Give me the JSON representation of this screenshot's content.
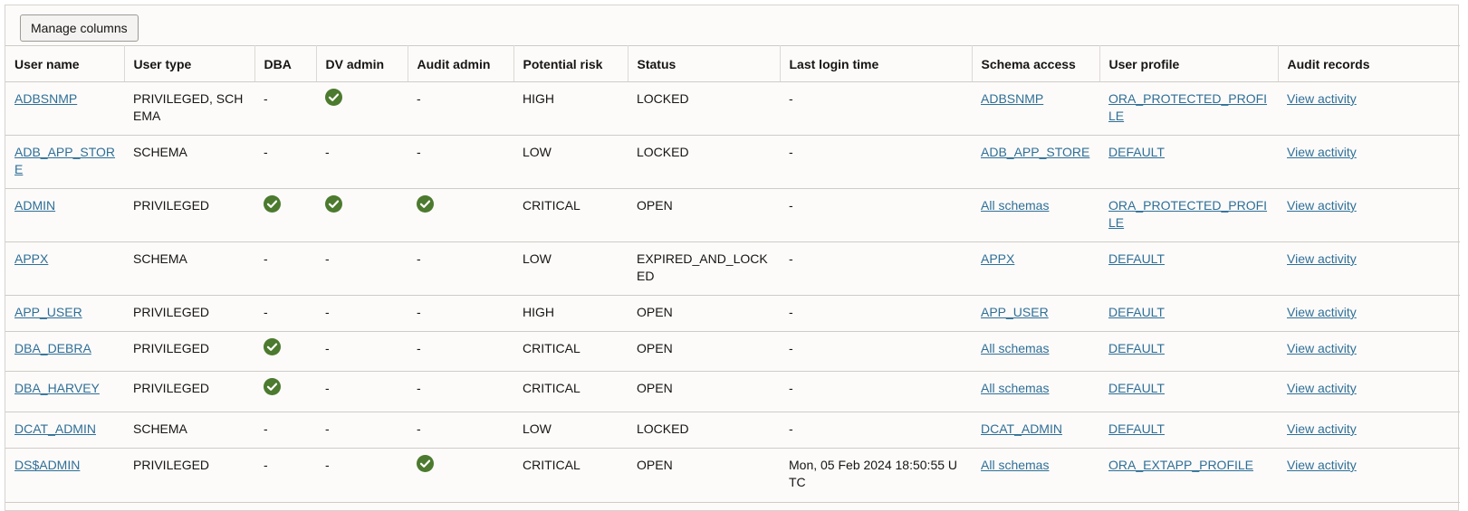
{
  "toolbar": {
    "manage_columns_label": "Manage columns"
  },
  "columns": [
    "User name",
    "User type",
    "DBA",
    "DV admin",
    "Audit admin",
    "Potential risk",
    "Status",
    "Last login time",
    "Schema access",
    "User profile",
    "Audit records"
  ],
  "colors": {
    "link": "#2f6f96",
    "check": "#4c7a2e",
    "border": "#cfccc7"
  },
  "icons": {
    "granted": "check-circle-icon"
  },
  "rows": [
    {
      "user_name": "ADBSNMP",
      "user_type": "PRIVILEGED, SCHEMA",
      "dba": false,
      "dv_admin": true,
      "audit_admin": false,
      "potential_risk": "HIGH",
      "status": "LOCKED",
      "last_login": "-",
      "schema_access": "ADBSNMP",
      "user_profile": "ORA_PROTECTED_PROFILE",
      "audit_records": "View activity"
    },
    {
      "user_name": "ADB_APP_STORE",
      "user_type": "SCHEMA",
      "dba": false,
      "dv_admin": false,
      "audit_admin": false,
      "potential_risk": "LOW",
      "status": "LOCKED",
      "last_login": "-",
      "schema_access": "ADB_APP_STORE",
      "user_profile": "DEFAULT",
      "audit_records": "View activity"
    },
    {
      "user_name": "ADMIN",
      "user_type": "PRIVILEGED",
      "dba": true,
      "dv_admin": true,
      "audit_admin": true,
      "potential_risk": "CRITICAL",
      "status": "OPEN",
      "last_login": "-",
      "schema_access": "All schemas",
      "user_profile": "ORA_PROTECTED_PROFILE",
      "audit_records": "View activity"
    },
    {
      "user_name": "APPX",
      "user_type": "SCHEMA",
      "dba": false,
      "dv_admin": false,
      "audit_admin": false,
      "potential_risk": "LOW",
      "status": "EXPIRED_AND_LOCKED",
      "last_login": "-",
      "schema_access": "APPX",
      "user_profile": "DEFAULT",
      "audit_records": "View activity"
    },
    {
      "user_name": "APP_USER",
      "user_type": "PRIVILEGED",
      "dba": false,
      "dv_admin": false,
      "audit_admin": false,
      "potential_risk": "HIGH",
      "status": "OPEN",
      "last_login": "-",
      "schema_access": "APP_USER",
      "user_profile": "DEFAULT",
      "audit_records": "View activity"
    },
    {
      "user_name": "DBA_DEBRA",
      "user_type": "PRIVILEGED",
      "dba": true,
      "dv_admin": false,
      "audit_admin": false,
      "potential_risk": "CRITICAL",
      "status": "OPEN",
      "last_login": "-",
      "schema_access": "All schemas",
      "user_profile": "DEFAULT",
      "audit_records": "View activity"
    },
    {
      "user_name": "DBA_HARVEY",
      "user_type": "PRIVILEGED",
      "dba": true,
      "dv_admin": false,
      "audit_admin": false,
      "potential_risk": "CRITICAL",
      "status": "OPEN",
      "last_login": "-",
      "schema_access": "All schemas",
      "user_profile": "DEFAULT",
      "audit_records": "View activity"
    },
    {
      "user_name": "DCAT_ADMIN",
      "user_type": "SCHEMA",
      "dba": false,
      "dv_admin": false,
      "audit_admin": false,
      "potential_risk": "LOW",
      "status": "LOCKED",
      "last_login": "-",
      "schema_access": "DCAT_ADMIN",
      "user_profile": "DEFAULT",
      "audit_records": "View activity"
    },
    {
      "user_name": "DS$ADMIN",
      "user_type": "PRIVILEGED",
      "dba": false,
      "dv_admin": false,
      "audit_admin": true,
      "potential_risk": "CRITICAL",
      "status": "OPEN",
      "last_login": "Mon, 05 Feb 2024 18:50:55 UTC",
      "schema_access": "All schemas",
      "user_profile": "ORA_EXTAPP_PROFILE",
      "audit_records": "View activity"
    }
  ],
  "empty_marker": "-"
}
